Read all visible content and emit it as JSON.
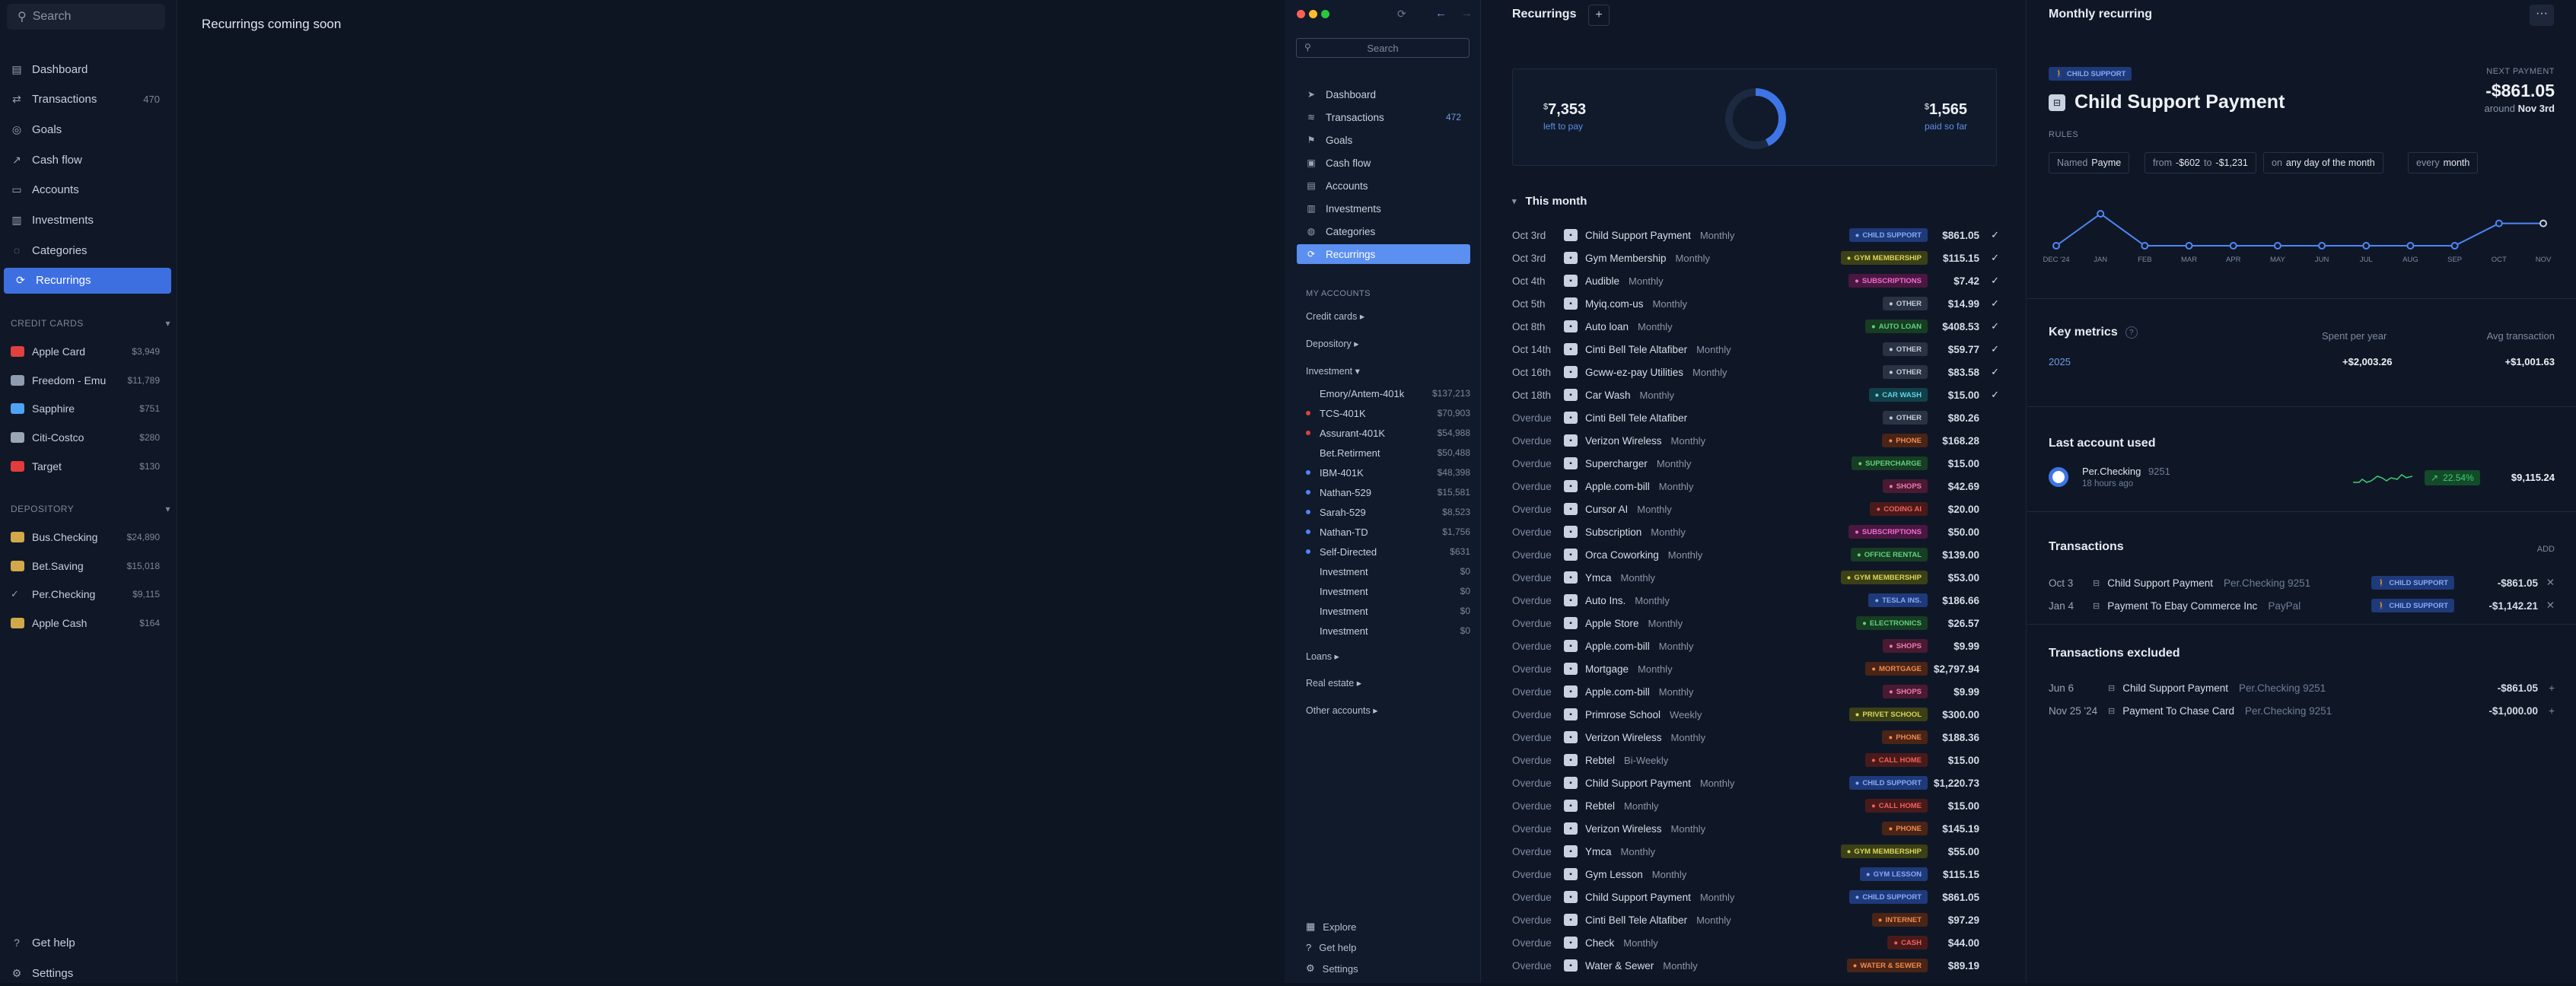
{
  "left": {
    "search_placeholder": "Search",
    "coming_soon": "Recurrings coming soon",
    "nav": [
      {
        "label": "Dashboard",
        "icon": "dashboard-icon",
        "glyph": "▤"
      },
      {
        "label": "Transactions",
        "icon": "transactions-icon",
        "glyph": "⇄",
        "count": "470"
      },
      {
        "label": "Goals",
        "icon": "goals-icon",
        "glyph": "◎"
      },
      {
        "label": "Cash flow",
        "icon": "cashflow-icon",
        "glyph": "↗"
      },
      {
        "label": "Accounts",
        "icon": "accounts-icon",
        "glyph": "▭"
      },
      {
        "label": "Investments",
        "icon": "investments-icon",
        "glyph": "▥"
      },
      {
        "label": "Categories",
        "icon": "categories-icon",
        "glyph": "◌"
      },
      {
        "label": "Recurrings",
        "icon": "recurrings-icon",
        "glyph": "⟳"
      }
    ],
    "credit_label": "CREDIT CARDS",
    "depository_label": "DEPOSITORY",
    "credit": [
      {
        "label": "Apple Card",
        "count": "$3,949",
        "color": "#e04040"
      },
      {
        "label": "Freedom - Emu",
        "count": "$11,789",
        "color": "#8f9bb0"
      },
      {
        "label": "Sapphire",
        "count": "$751",
        "color": "#4fa3f7"
      },
      {
        "label": "Citi-Costco",
        "count": "$280",
        "color": "#9aa5b5"
      },
      {
        "label": "Target",
        "count": "$130",
        "color": "#e23c3c"
      }
    ],
    "depository": [
      {
        "label": "Bus.Checking",
        "count": "$24,890",
        "color": "#d1a94a"
      },
      {
        "label": "Bet.Saving",
        "count": "$15,018",
        "color": "#d1a94a"
      },
      {
        "label": "Per.Checking",
        "count": "$9,115",
        "color": "check"
      },
      {
        "label": "Apple Cash",
        "count": "$164",
        "color": "#d1a94a"
      }
    ],
    "footer": {
      "help": "Get help",
      "settings": "Settings"
    }
  },
  "right_sidebar": {
    "search_placeholder": "Search",
    "nav": [
      {
        "label": "Dashboard",
        "glyph": "➤",
        "icon": "dashboard-icon"
      },
      {
        "label": "Transactions",
        "glyph": "≋",
        "icon": "transactions-icon",
        "count": "472"
      },
      {
        "label": "Goals",
        "glyph": "⚑",
        "icon": "goals-icon"
      },
      {
        "label": "Cash flow",
        "glyph": "▣",
        "icon": "cashflow-icon"
      },
      {
        "label": "Accounts",
        "glyph": "▤",
        "icon": "accounts-icon"
      },
      {
        "label": "Investments",
        "glyph": "▥",
        "icon": "investments-icon"
      },
      {
        "label": "Categories",
        "glyph": "◍",
        "icon": "categories-icon"
      },
      {
        "label": "Recurrings",
        "glyph": "⟳",
        "icon": "recurrings-icon"
      }
    ],
    "my_accounts": "MY ACCOUNTS",
    "credit_cards": "Credit cards ▸",
    "depository": "Depository ▸",
    "investment": "Investment ▾",
    "investments": [
      {
        "label": "Emory/Antem-401k",
        "count": "$137,213",
        "dot": ""
      },
      {
        "label": "TCS-401K",
        "count": "$70,903",
        "dot": "#e04040"
      },
      {
        "label": "Assurant-401K",
        "count": "$54,988",
        "dot": "#e04040"
      },
      {
        "label": "Bet.Retirment",
        "count": "$50,488",
        "dot": ""
      },
      {
        "label": "IBM-401K",
        "count": "$48,398",
        "dot": "#4f86f7"
      },
      {
        "label": "Nathan-529",
        "count": "$15,581",
        "dot": "#4f86f7"
      },
      {
        "label": "Sarah-529",
        "count": "$8,523",
        "dot": "#4f86f7"
      },
      {
        "label": "Nathan-TD",
        "count": "$1,756",
        "dot": "#4f86f7"
      },
      {
        "label": "Self-Directed",
        "count": "$631",
        "dot": "#4f86f7"
      },
      {
        "label": "Investment",
        "count": "$0",
        "dot": ""
      },
      {
        "label": "Investment",
        "count": "$0",
        "dot": ""
      },
      {
        "label": "Investment",
        "count": "$0",
        "dot": ""
      },
      {
        "label": "Investment",
        "count": "$0",
        "dot": ""
      }
    ],
    "loans": "Loans ▸",
    "real_estate": "Real estate ▸",
    "other": "Other accounts ▸",
    "footer": {
      "explore": "Explore",
      "help": "Get help",
      "settings": "Settings"
    }
  },
  "recurrings": {
    "title": "Recurrings",
    "add": "+",
    "left_amount": "7,353",
    "left_label": "left to pay",
    "paid_amount": "1,565",
    "paid_label": "paid so far",
    "section": "This month",
    "rows": [
      {
        "date": "Oct 3rd",
        "name": "Child Support Payment",
        "freq": "Monthly",
        "tag": "CHILD SUPPORT",
        "tc": "blue",
        "amt": "$861.05",
        "chk": "✓"
      },
      {
        "date": "Oct 3rd",
        "name": "Gym Membership",
        "freq": "Monthly",
        "tag": "GYM MEMBERSHIP",
        "tc": "olive",
        "amt": "$115.15",
        "chk": "✓"
      },
      {
        "date": "Oct 4th",
        "name": "Audible",
        "freq": "Monthly",
        "tag": "SUBSCRIPTIONS",
        "tc": "magenta",
        "amt": "$7.42",
        "chk": "✓"
      },
      {
        "date": "Oct 5th",
        "name": "Myiq.com-us",
        "freq": "Monthly",
        "tag": "OTHER",
        "tc": "gray",
        "amt": "$14.99",
        "chk": "✓"
      },
      {
        "date": "Oct 8th",
        "name": "Auto loan",
        "freq": "Monthly",
        "tag": "AUTO LOAN",
        "tc": "green",
        "amt": "$408.53",
        "chk": "✓"
      },
      {
        "date": "Oct 14th",
        "name": "Cinti Bell Tele Altafiber",
        "freq": "Monthly",
        "tag": "OTHER",
        "tc": "gray",
        "amt": "$59.77",
        "chk": "✓"
      },
      {
        "date": "Oct 16th",
        "name": "Gcww-ez-pay Utilities",
        "freq": "Monthly",
        "tag": "OTHER",
        "tc": "gray",
        "amt": "$83.58",
        "chk": "✓"
      },
      {
        "date": "Oct 18th",
        "name": "Car Wash",
        "freq": "Monthly",
        "tag": "CAR WASH",
        "tc": "teal",
        "amt": "$15.00",
        "chk": "✓"
      },
      {
        "date": "Overdue",
        "name": "Cinti Bell Tele Altafiber",
        "freq": "",
        "tag": "OTHER",
        "tc": "gray",
        "amt": "$80.26",
        "chk": ""
      },
      {
        "date": "Overdue",
        "name": "Verizon Wireless",
        "freq": "Monthly",
        "tag": "PHONE",
        "tc": "orange",
        "amt": "$168.28",
        "chk": ""
      },
      {
        "date": "Overdue",
        "name": "Supercharger",
        "freq": "Monthly",
        "tag": "SUPERCHARGE",
        "tc": "green",
        "amt": "$15.00",
        "chk": ""
      },
      {
        "date": "Overdue",
        "name": "Apple.com-bill",
        "freq": "Monthly",
        "tag": "SHOPS",
        "tc": "pink",
        "amt": "$42.69",
        "chk": ""
      },
      {
        "date": "Overdue",
        "name": "Cursor AI",
        "freq": "Monthly",
        "tag": "CODING AI",
        "tc": "red",
        "amt": "$20.00",
        "chk": ""
      },
      {
        "date": "Overdue",
        "name": "Subscription",
        "freq": "Monthly",
        "tag": "SUBSCRIPTIONS",
        "tc": "magenta",
        "amt": "$50.00",
        "chk": ""
      },
      {
        "date": "Overdue",
        "name": "Orca Coworking",
        "freq": "Monthly",
        "tag": "OFFICE RENTAL",
        "tc": "green",
        "amt": "$139.00",
        "chk": ""
      },
      {
        "date": "Overdue",
        "name": "Ymca",
        "freq": "Monthly",
        "tag": "GYM MEMBERSHIP",
        "tc": "olive",
        "amt": "$53.00",
        "chk": ""
      },
      {
        "date": "Overdue",
        "name": "Auto Ins.",
        "freq": "Monthly",
        "tag": "TESLA INS.",
        "tc": "blue",
        "amt": "$186.66",
        "chk": ""
      },
      {
        "date": "Overdue",
        "name": "Apple Store",
        "freq": "Monthly",
        "tag": "ELECTRONICS",
        "tc": "green",
        "amt": "$26.57",
        "chk": ""
      },
      {
        "date": "Overdue",
        "name": "Apple.com-bill",
        "freq": "Monthly",
        "tag": "SHOPS",
        "tc": "pink",
        "amt": "$9.99",
        "chk": ""
      },
      {
        "date": "Overdue",
        "name": "Mortgage",
        "freq": "Monthly",
        "tag": "MORTGAGE",
        "tc": "orange",
        "amt": "$2,797.94",
        "chk": ""
      },
      {
        "date": "Overdue",
        "name": "Apple.com-bill",
        "freq": "Monthly",
        "tag": "SHOPS",
        "tc": "pink",
        "amt": "$9.99",
        "chk": ""
      },
      {
        "date": "Overdue",
        "name": "Primrose School",
        "freq": "Weekly",
        "tag": "PRIVET SCHOOL",
        "tc": "olive",
        "amt": "$300.00",
        "chk": ""
      },
      {
        "date": "Overdue",
        "name": "Verizon Wireless",
        "freq": "Monthly",
        "tag": "PHONE",
        "tc": "orange",
        "amt": "$188.36",
        "chk": ""
      },
      {
        "date": "Overdue",
        "name": "Rebtel",
        "freq": "Bi-Weekly",
        "tag": "CALL HOME",
        "tc": "red",
        "amt": "$15.00",
        "chk": ""
      },
      {
        "date": "Overdue",
        "name": "Child Support Payment",
        "freq": "Monthly",
        "tag": "CHILD SUPPORT",
        "tc": "blue",
        "amt": "$1,220.73",
        "chk": ""
      },
      {
        "date": "Overdue",
        "name": "Rebtel",
        "freq": "Monthly",
        "tag": "CALL HOME",
        "tc": "red",
        "amt": "$15.00",
        "chk": ""
      },
      {
        "date": "Overdue",
        "name": "Verizon Wireless",
        "freq": "Monthly",
        "tag": "PHONE",
        "tc": "orange",
        "amt": "$145.19",
        "chk": ""
      },
      {
        "date": "Overdue",
        "name": "Ymca",
        "freq": "Monthly",
        "tag": "GYM MEMBERSHIP",
        "tc": "olive",
        "amt": "$55.00",
        "chk": ""
      },
      {
        "date": "Overdue",
        "name": "Gym Lesson",
        "freq": "Monthly",
        "tag": "GYM LESSON",
        "tc": "blue",
        "amt": "$115.15",
        "chk": ""
      },
      {
        "date": "Overdue",
        "name": "Child Support Payment",
        "freq": "Monthly",
        "tag": "CHILD SUPPORT",
        "tc": "blue",
        "amt": "$861.05",
        "chk": ""
      },
      {
        "date": "Overdue",
        "name": "Cinti Bell Tele Altafiber",
        "freq": "Monthly",
        "tag": "INTERNET",
        "tc": "orange",
        "amt": "$97.29",
        "chk": ""
      },
      {
        "date": "Overdue",
        "name": "Check",
        "freq": "Monthly",
        "tag": "CASH",
        "tc": "red",
        "amt": "$44.00",
        "chk": ""
      },
      {
        "date": "Overdue",
        "name": "Water & Sewer",
        "freq": "Monthly",
        "tag": "WATER & SEWER",
        "tc": "orange",
        "amt": "$89.19",
        "chk": ""
      }
    ]
  },
  "detail": {
    "title": "Monthly recurring",
    "more": "···",
    "badge": "CHILD SUPPORT",
    "name": "Child Support Payment",
    "next_label": "NEXT PAYMENT",
    "next_amount": "-$861.05",
    "next_around": "around",
    "next_date": "Nov 3rd",
    "rules_label": "RULES",
    "rules": [
      {
        "a": "Named",
        "b": "Payme",
        "c": "",
        "d": ""
      },
      {
        "a": "from",
        "b": "-$602",
        "c": "to",
        "d": "-$1,231"
      },
      {
        "a": "on",
        "b": "any day of the month",
        "c": "",
        "d": ""
      },
      {
        "a": "every",
        "b": "month",
        "c": "",
        "d": ""
      }
    ],
    "months": [
      "DEC '24",
      "JAN",
      "FEB",
      "MAR",
      "APR",
      "MAY",
      "JUN",
      "JUL",
      "AUG",
      "SEP",
      "OCT",
      "NOV"
    ],
    "key_metrics": "Key metrics",
    "spent_label": "Spent per year",
    "avg_label": "Avg transaction",
    "year": "2025",
    "spent": "+$2,003.26",
    "avg": "+$1,001.63",
    "last_account": "Last account used",
    "acct_name": "Per.Checking",
    "acct_num": "9251",
    "acct_time": "18 hours ago",
    "acct_pct": "22.54%",
    "acct_bal": "$9,115.24",
    "transactions": "Transactions",
    "add": "ADD",
    "tx": [
      {
        "date": "Oct 3",
        "name": "Child Support Payment",
        "acct": "Per.Checking 9251",
        "tag": "CHILD SUPPORT",
        "amt": "-$861.05"
      },
      {
        "date": "Jan 4",
        "name": "Payment To Ebay Commerce Inc",
        "acct": "PayPal",
        "tag": "CHILD SUPPORT",
        "amt": "-$1,142.21"
      }
    ],
    "excluded": "Transactions excluded",
    "ex": [
      {
        "date": "Jun 6",
        "name": "Child Support Payment",
        "acct": "Per.Checking 9251",
        "amt": "-$861.05"
      },
      {
        "date": "Nov 25 '24",
        "name": "Payment To Chase Card",
        "acct": "Per.Checking 9251",
        "amt": "-$1,000.00"
      }
    ]
  }
}
